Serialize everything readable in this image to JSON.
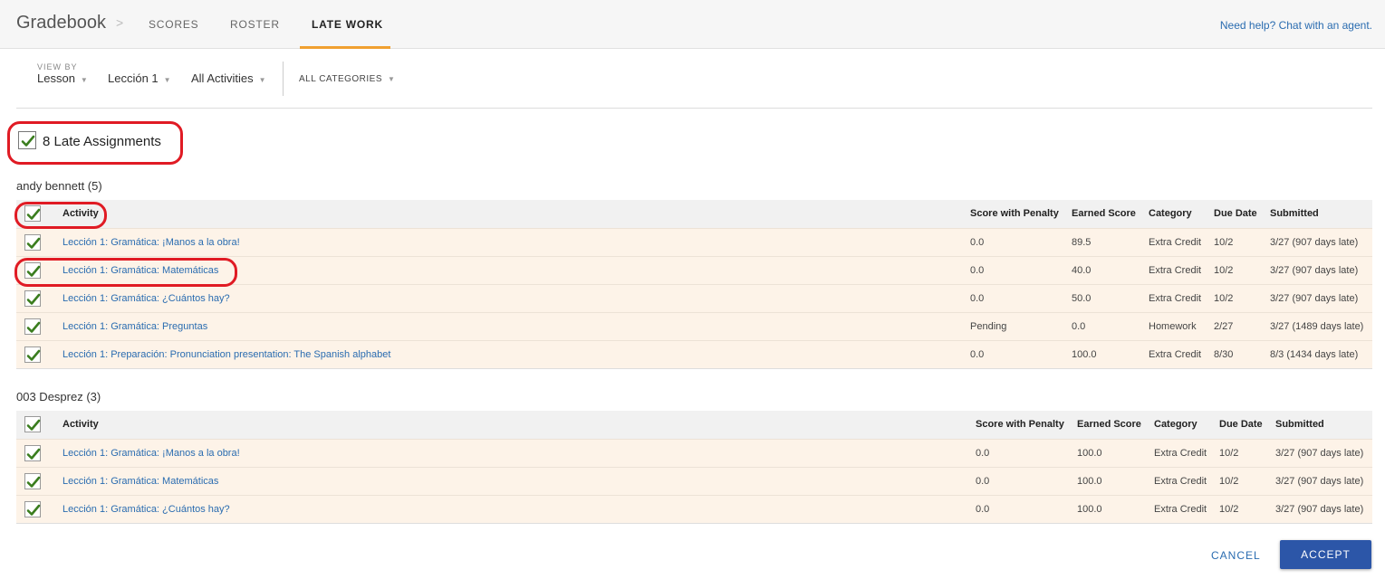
{
  "topnav": {
    "brand": "Gradebook",
    "separator": ">",
    "tabs": [
      {
        "label": "SCORES",
        "active": false
      },
      {
        "label": "ROSTER",
        "active": false
      },
      {
        "label": "LATE WORK",
        "active": true
      }
    ],
    "help_link": "Need help? Chat with an agent.",
    "accent_color": "#f0a030"
  },
  "filters": {
    "view_by_label": "VIEW BY",
    "view_by_value": "Lesson",
    "lesson_value": "Lección 1",
    "activities_value": "All Activities",
    "categories_value": "ALL CATEGORIES"
  },
  "late_summary": {
    "label": "8 Late Assignments",
    "checked": true
  },
  "columns": [
    "Activity",
    "Score with Penalty",
    "Earned Score",
    "Category",
    "Due Date",
    "Submitted"
  ],
  "groups": [
    {
      "title": "andy bennett (5)",
      "rows": [
        {
          "activity": "Lección 1: Gramática: ¡Manos a la obra!",
          "score_with_penalty": "0.0",
          "earned_score": "89.5",
          "category": "Extra Credit",
          "due_date": "10/2",
          "submitted": "3/27 (907 days late)"
        },
        {
          "activity": "Lección 1: Gramática: Matemáticas",
          "score_with_penalty": "0.0",
          "earned_score": "40.0",
          "category": "Extra Credit",
          "due_date": "10/2",
          "submitted": "3/27 (907 days late)"
        },
        {
          "activity": "Lección 1: Gramática: ¿Cuántos hay?",
          "score_with_penalty": "0.0",
          "earned_score": "50.0",
          "category": "Extra Credit",
          "due_date": "10/2",
          "submitted": "3/27 (907 days late)"
        },
        {
          "activity": "Lección 1: Gramática: Preguntas",
          "score_with_penalty": "Pending",
          "earned_score": "0.0",
          "category": "Homework",
          "due_date": "2/27",
          "submitted": "3/27 (1489 days late)"
        },
        {
          "activity": "Lección 1: Preparación: Pronunciation presentation: The Spanish alphabet",
          "score_with_penalty": "0.0",
          "earned_score": "100.0",
          "category": "Extra Credit",
          "due_date": "8/30",
          "submitted": "8/3 (1434 days late)"
        }
      ]
    },
    {
      "title": "003 Desprez (3)",
      "rows": [
        {
          "activity": "Lección 1: Gramática: ¡Manos a la obra!",
          "score_with_penalty": "0.0",
          "earned_score": "100.0",
          "category": "Extra Credit",
          "due_date": "10/2",
          "submitted": "3/27 (907 days late)"
        },
        {
          "activity": "Lección 1: Gramática: Matemáticas",
          "score_with_penalty": "0.0",
          "earned_score": "100.0",
          "category": "Extra Credit",
          "due_date": "10/2",
          "submitted": "3/27 (907 days late)"
        },
        {
          "activity": "Lección 1: Gramática: ¿Cuántos hay?",
          "score_with_penalty": "0.0",
          "earned_score": "100.0",
          "category": "Extra Credit",
          "due_date": "10/2",
          "submitted": "3/27 (907 days late)"
        }
      ]
    }
  ],
  "footer": {
    "cancel_label": "CANCEL",
    "accept_label": "ACCEPT",
    "accept_color": "#2c56a8"
  },
  "annotation_color": "#e01b24",
  "check_color": "#3a7d1e"
}
